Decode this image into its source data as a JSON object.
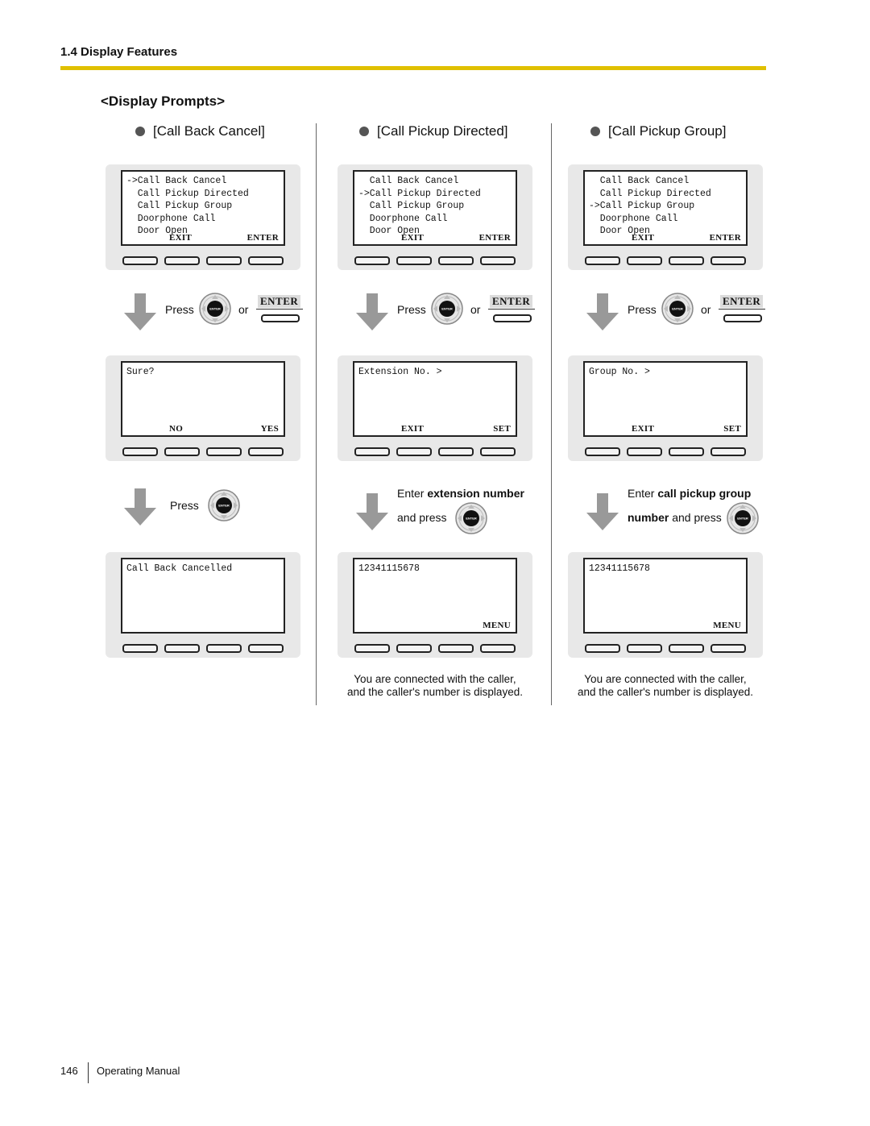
{
  "header": {
    "section": "1.4 Display Features",
    "accent_color": "#e0c000"
  },
  "heading": "<Display Prompts>",
  "columns": [
    {
      "title": "[Call Back Cancel]",
      "screen1": {
        "lines": "->Call Back Cancel\n  Call Pickup Directed\n  Call Pickup Group\n  Doorphone Call\n  Door Open",
        "soft_left": "EXIT",
        "soft_right": "ENTER"
      },
      "step1": {
        "press": "Press",
        "or": "or",
        "enter_key": "ENTER",
        "nav_label": "ENTER"
      },
      "screen2": {
        "lines": "Sure?",
        "soft_left": "NO",
        "soft_right": "YES"
      },
      "step2": {
        "press": "Press"
      },
      "screen3": {
        "lines": "Call Back Cancelled",
        "soft_right": ""
      },
      "note": ""
    },
    {
      "title": "[Call Pickup Directed]",
      "screen1": {
        "lines": "  Call Back Cancel\n->Call Pickup Directed\n  Call Pickup Group\n  Doorphone Call\n  Door Open",
        "soft_left": "EXIT",
        "soft_right": "ENTER"
      },
      "step1": {
        "press": "Press",
        "or": "or",
        "enter_key": "ENTER"
      },
      "screen2": {
        "lines": "Extension No. >",
        "soft_left": "EXIT",
        "soft_right": "SET"
      },
      "step2": {
        "enter": "Enter ",
        "bold": "extension number",
        "and_press": "and press"
      },
      "screen3": {
        "lines": "12341115678",
        "soft_right": "MENU"
      },
      "note": "You are connected with the caller,\nand the caller's number is displayed."
    },
    {
      "title": "[Call Pickup Group]",
      "screen1": {
        "lines": "  Call Back Cancel\n  Call Pickup Directed\n->Call Pickup Group\n  Doorphone Call\n  Door Open",
        "soft_left": "EXIT",
        "soft_right": "ENTER"
      },
      "step1": {
        "press": "Press",
        "or": "or",
        "enter_key": "ENTER"
      },
      "screen2": {
        "lines": "Group No. >",
        "soft_left": "EXIT",
        "soft_right": "SET"
      },
      "step2": {
        "enter": "Enter ",
        "bold": "call pickup group",
        "bold2": "number",
        "and_press": " and press"
      },
      "screen3": {
        "lines": "12341115678",
        "soft_right": "MENU"
      },
      "note": "You are connected with the caller,\nand the caller's number is displayed."
    }
  ],
  "footer": {
    "page": "146",
    "title": "Operating Manual"
  }
}
